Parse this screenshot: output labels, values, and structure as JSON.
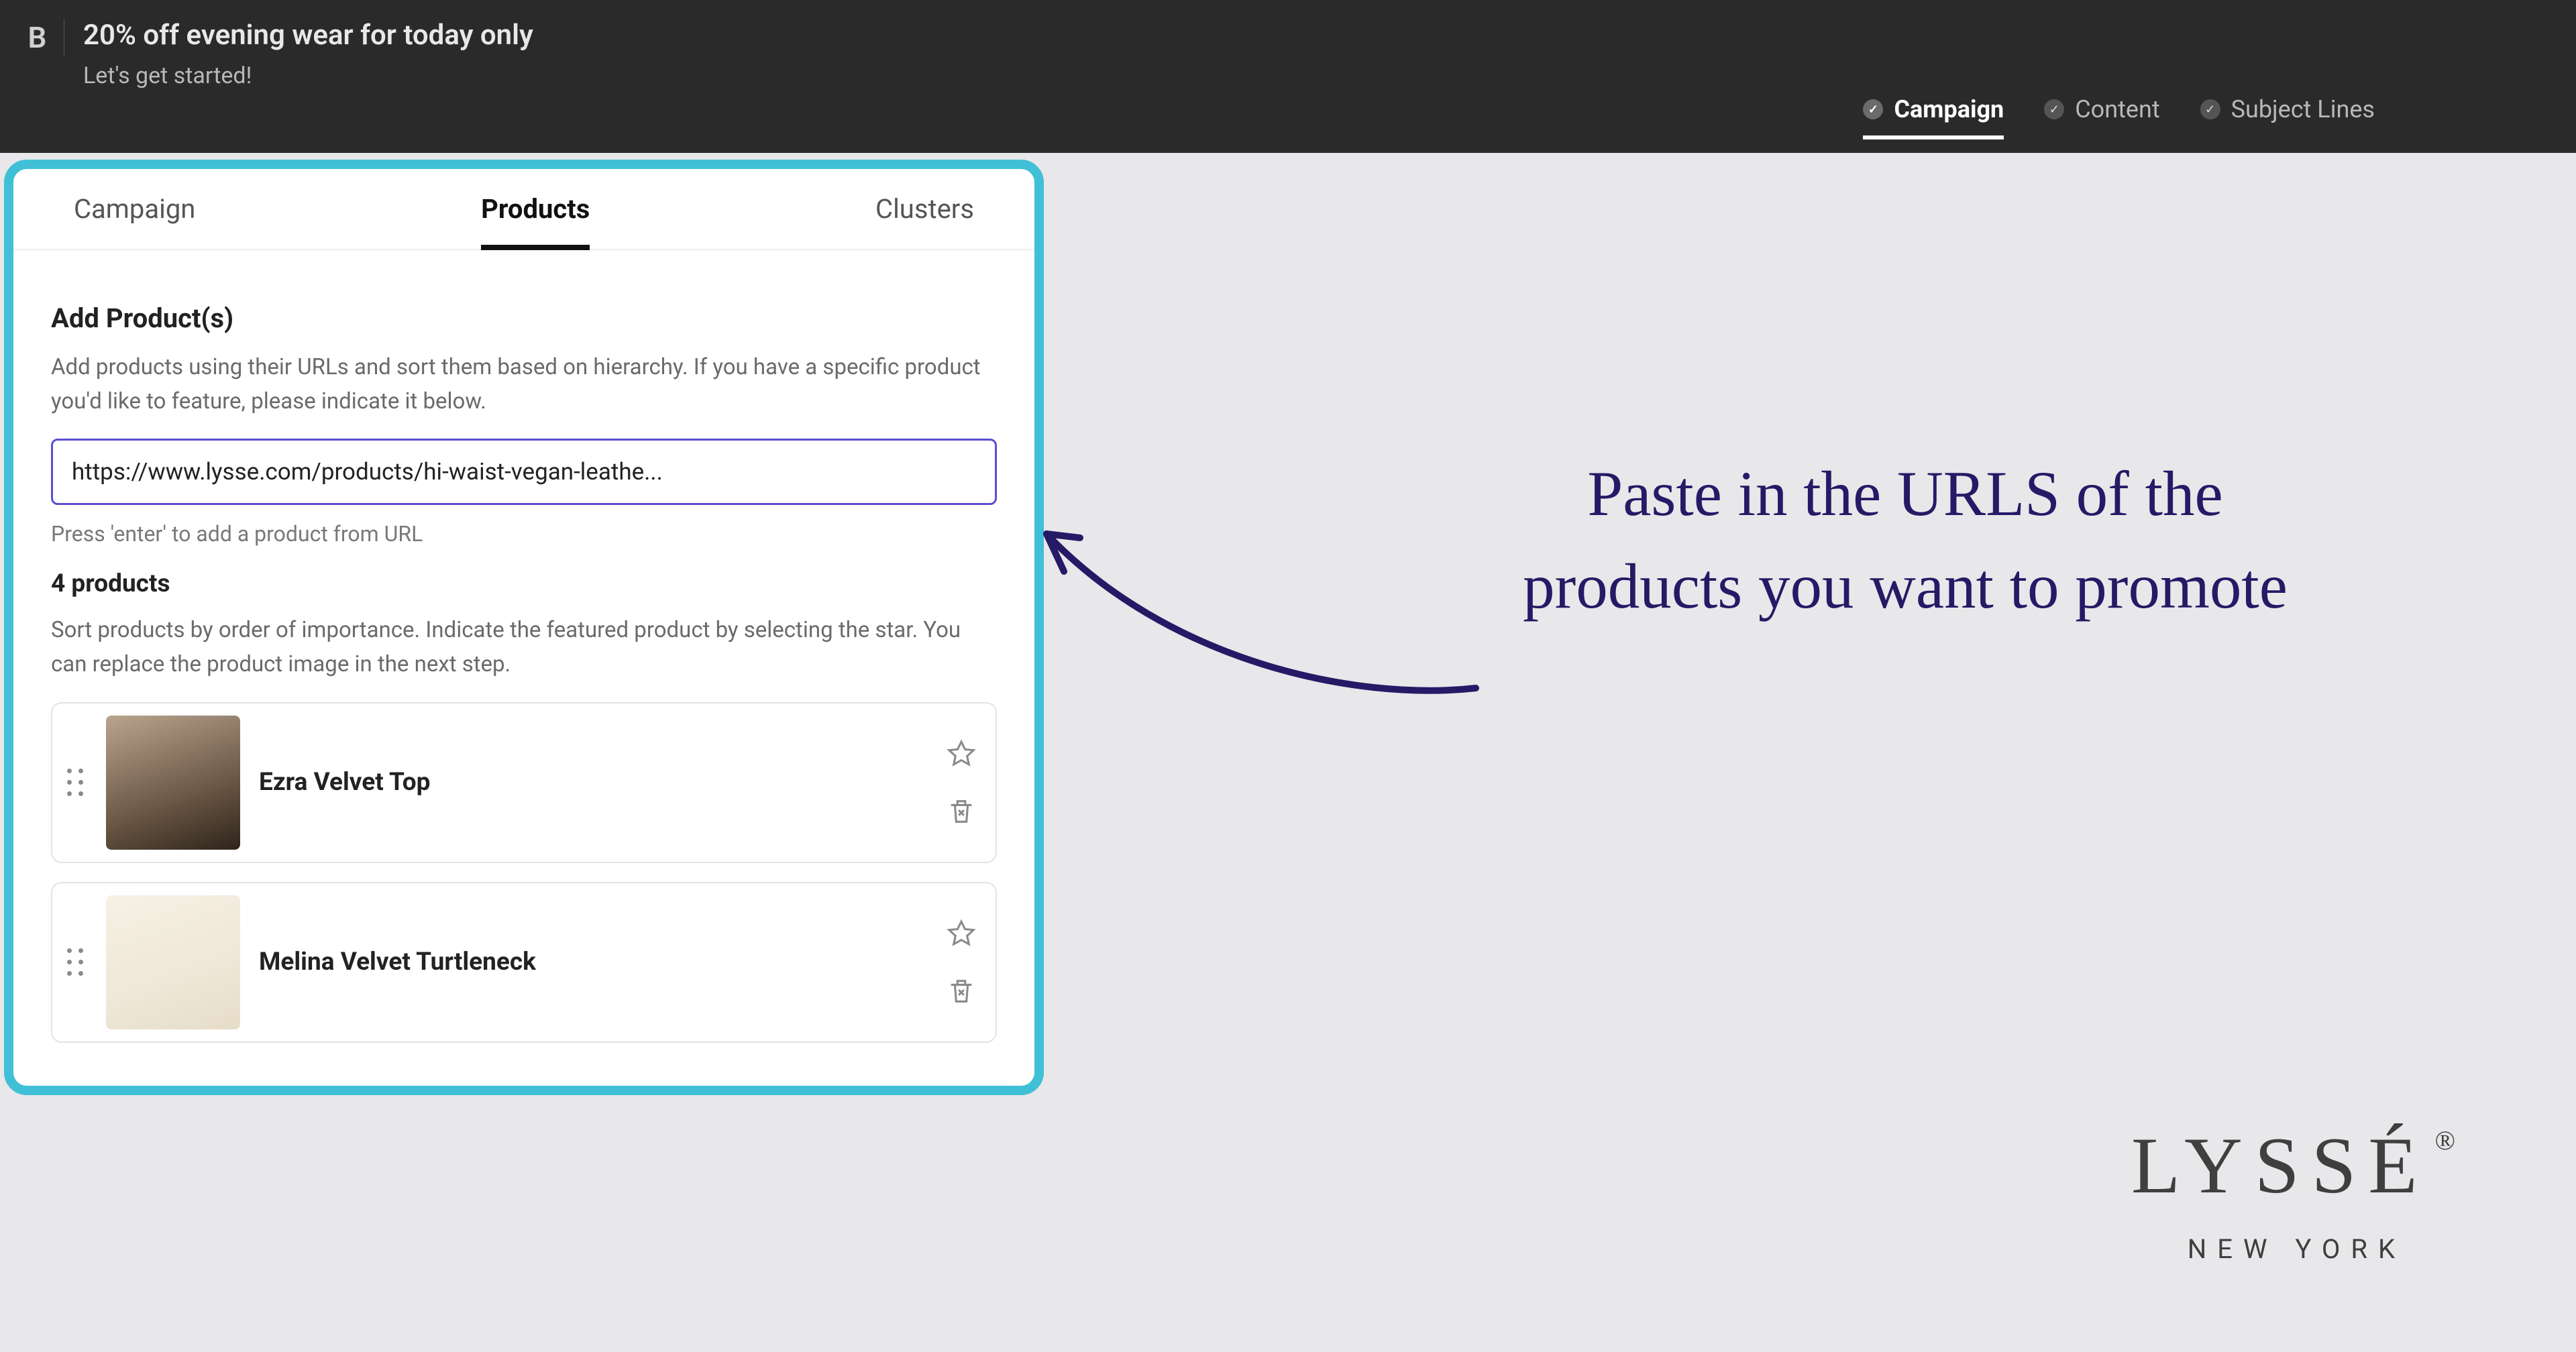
{
  "header": {
    "logo_letter": "B",
    "title": "20% off evening wear for today only",
    "subtitle": "Let's get started!"
  },
  "steps": [
    {
      "label": "Campaign",
      "active": true
    },
    {
      "label": "Content",
      "active": false
    },
    {
      "label": "Subject Lines",
      "active": false
    }
  ],
  "panel": {
    "tabs": [
      {
        "label": "Campaign",
        "active": false
      },
      {
        "label": "Products",
        "active": true
      },
      {
        "label": "Clusters",
        "active": false
      }
    ],
    "add_title": "Add Product(s)",
    "add_help": "Add products using their URLs and sort them based on hierarchy. If you have a specific product you'd like to feature, please indicate it below.",
    "url_value": "https://www.lysse.com/products/hi-waist-vegan-leathe...",
    "url_hint": "Press 'enter' to add a product from URL",
    "count_label": "4 products",
    "sort_help": "Sort products by order of importance. Indicate the featured product by selecting the star. You can replace the product image in the next step.",
    "products": [
      {
        "name": "Ezra Velvet Top"
      },
      {
        "name": "Melina Velvet Turtleneck"
      }
    ]
  },
  "annotation": {
    "text": "Paste in the URLS of the products you want to promote"
  },
  "brand": {
    "name": "LYSSÉ",
    "reg": "®",
    "sub": "NEW YORK"
  }
}
